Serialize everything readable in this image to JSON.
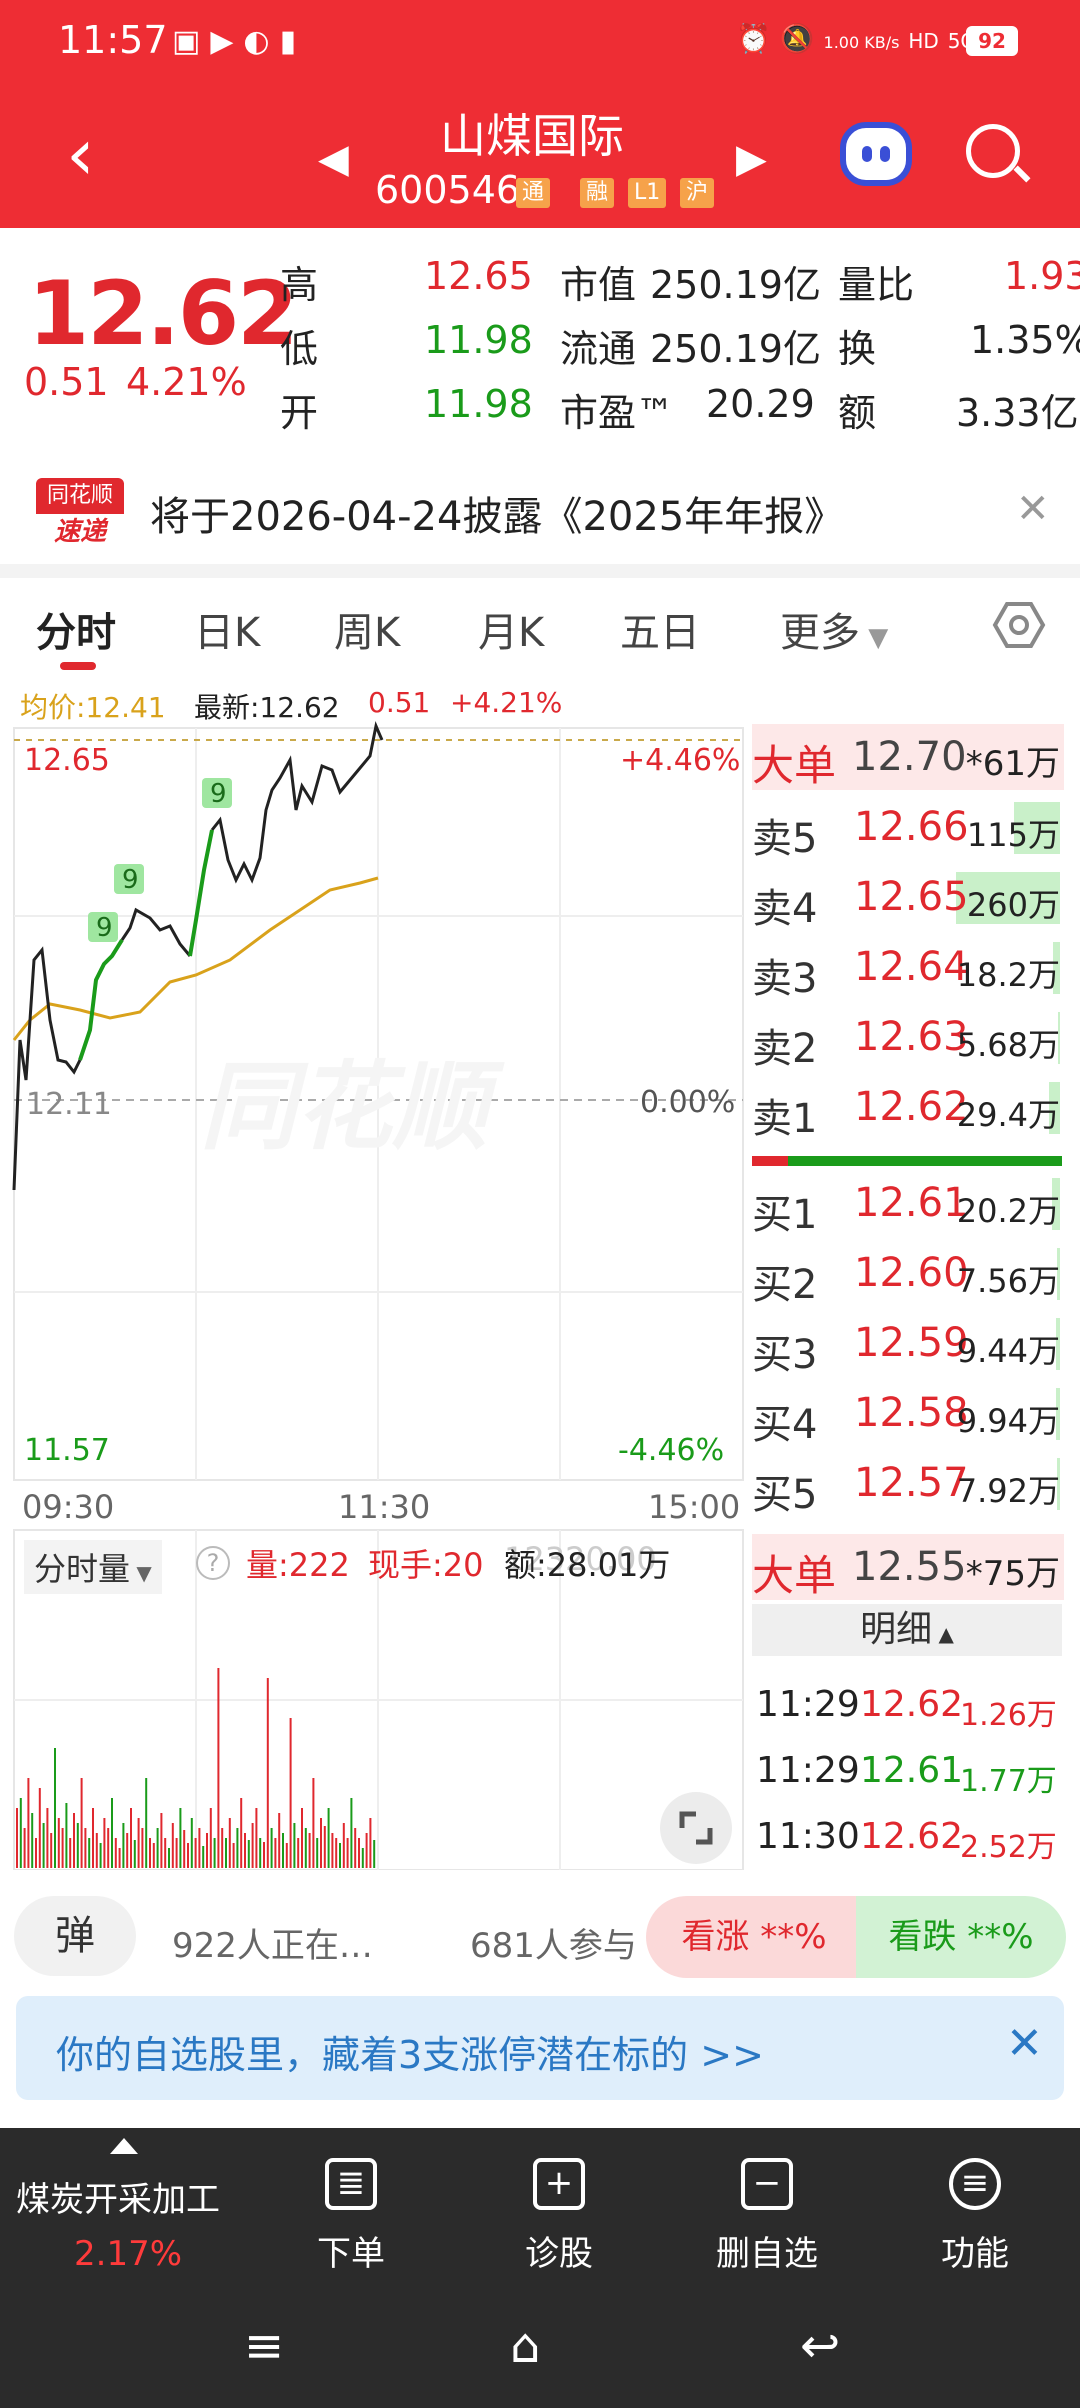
{
  "status_bar": {
    "time": "11:57",
    "net_speed": "1.00 KB/s",
    "hd": "HD",
    "signal": "5G",
    "battery": "92"
  },
  "header": {
    "stock_name": "山煤国际",
    "stock_code": "600546",
    "tags": [
      "通",
      "融",
      "L1",
      "沪"
    ]
  },
  "quote": {
    "price": "12.62",
    "change": "0.51",
    "change_pct": "4.21%",
    "fields": [
      {
        "label": "高",
        "value": "12.65",
        "color": "#e0282e"
      },
      {
        "label": "低",
        "value": "11.98",
        "color": "#1a9b1a"
      },
      {
        "label": "开",
        "value": "11.98",
        "color": "#1a9b1a"
      }
    ],
    "mid_fields": [
      {
        "label": "市值",
        "value": "250.19亿"
      },
      {
        "label": "流通",
        "value": "250.19亿"
      },
      {
        "label": "市盈™",
        "value": "20.29"
      }
    ],
    "right_fields": [
      {
        "label": "量比",
        "value": "1.93",
        "color": "#e0282e"
      },
      {
        "label": "换",
        "value": "1.35%",
        "color": "#222"
      },
      {
        "label": "额",
        "value": "3.33亿",
        "color": "#222"
      }
    ]
  },
  "notice": {
    "logo_top": "同花顺",
    "logo_bottom": "速递",
    "text": "将于2026-04-24披露《2025年年报》"
  },
  "tabs": [
    "分时",
    "日K",
    "周K",
    "月K",
    "五日",
    "更多"
  ],
  "info_line": {
    "avg": "均价:12.41",
    "latest": "最新:12.62",
    "change": "0.51",
    "change_pct": "+4.21%"
  },
  "chart": {
    "upper_price": "12.65",
    "base_price": "12.11",
    "lower_price": "11.57",
    "upper_pct": "+4.46%",
    "base_pct": "0.00%",
    "lower_pct": "-4.46%",
    "watermark": "同花顺",
    "times": [
      "09:30",
      "11:30",
      "15:00"
    ],
    "marker_label": "9"
  },
  "order_book": {
    "big_sell": {
      "label": "大单",
      "price": "12.70",
      "vol": "*61万"
    },
    "sells": [
      {
        "label": "卖5",
        "price": "12.66",
        "vol": "115万",
        "bar": 0.44
      },
      {
        "label": "卖4",
        "price": "12.65",
        "vol": "260万",
        "bar": 1.0
      },
      {
        "label": "卖3",
        "price": "12.64",
        "vol": "18.2万",
        "bar": 0.07
      },
      {
        "label": "卖2",
        "price": "12.63",
        "vol": "5.68万",
        "bar": 0.02
      },
      {
        "label": "卖1",
        "price": "12.62",
        "vol": "29.4万",
        "bar": 0.11
      }
    ],
    "buys": [
      {
        "label": "买1",
        "price": "12.61",
        "vol": "20.2万",
        "bar": 0.08
      },
      {
        "label": "买2",
        "price": "12.60",
        "vol": "7.56万",
        "bar": 0.03
      },
      {
        "label": "买3",
        "price": "12.59",
        "vol": "9.44万",
        "bar": 0.04
      },
      {
        "label": "买4",
        "price": "12.58",
        "vol": "9.94万",
        "bar": 0.04
      },
      {
        "label": "买5",
        "price": "12.57",
        "vol": "7.92万",
        "bar": 0.03
      }
    ],
    "big_buy": {
      "label": "大单",
      "price": "12.55",
      "vol": "*75万"
    },
    "detail_label": "明细",
    "ticks": [
      {
        "time": "11:29",
        "price": "12.62",
        "vol": "1.26万",
        "color": "#e0282e"
      },
      {
        "time": "11:29",
        "price": "12.61",
        "vol": "1.77万",
        "color": "#1a9b1a"
      },
      {
        "time": "11:30",
        "price": "12.62",
        "vol": "2.52万",
        "color": "#e0282e"
      }
    ]
  },
  "volume": {
    "selector": "分时量",
    "amount": "量:222",
    "hand": "现手:20",
    "money": "额:28.01万",
    "max_label": "12320.00"
  },
  "social": {
    "danmu": "弹",
    "watching": "922人正在…",
    "participants": "681人参与",
    "rise": "看涨 **%",
    "fall": "看跌 **%"
  },
  "promo": {
    "text": "你的自选股里，藏着3支涨停潜在标的 >>"
  },
  "bottom_bar": {
    "sector": "煤炭开采加工",
    "sector_pct": "2.17%",
    "items": [
      {
        "label": "下单",
        "icon": "order-icon"
      },
      {
        "label": "诊股",
        "icon": "diagnose-icon"
      },
      {
        "label": "删自选",
        "icon": "remove-watch-icon"
      },
      {
        "label": "功能",
        "icon": "menu-icon"
      }
    ]
  },
  "colors": {
    "brand": "#ee2d34",
    "up": "#e0282e",
    "down": "#1a9b1a",
    "avg_line": "#d9a21b"
  }
}
